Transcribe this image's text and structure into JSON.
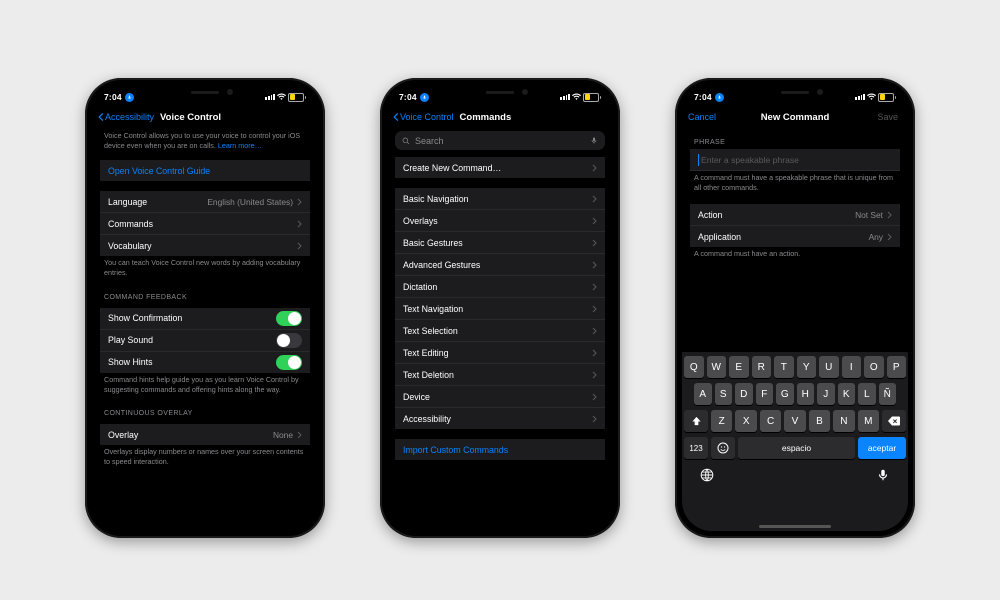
{
  "status": {
    "time": "7:04"
  },
  "p1": {
    "back": "Accessibility",
    "title": "Voice Control",
    "intro_a": "Voice Control allows you to use your voice to control your iOS device even when you are on calls. ",
    "intro_link": "Learn more…",
    "guide": "Open Voice Control Guide",
    "lang_label": "Language",
    "lang_value": "English (United States)",
    "cmds": "Commands",
    "vocab": "Vocabulary",
    "vocab_note": "You can teach Voice Control new words by adding vocabulary entries.",
    "sec_feedback": "COMMAND FEEDBACK",
    "conf": "Show Confirmation",
    "sound": "Play Sound",
    "hints": "Show Hints",
    "hints_note": "Command hints help guide you as you learn Voice Control by suggesting commands and offering hints along the way.",
    "sec_overlay": "CONTINUOUS OVERLAY",
    "overlay": "Overlay",
    "overlay_val": "None",
    "overlay_note": "Overlays display numbers or names over your screen contents to speed interaction."
  },
  "p2": {
    "back": "Voice Control",
    "title": "Commands",
    "search_ph": "Search",
    "create": "Create New Command…",
    "categories": [
      "Basic Navigation",
      "Overlays",
      "Basic Gestures",
      "Advanced Gestures",
      "Dictation",
      "Text Navigation",
      "Text Selection",
      "Text Editing",
      "Text Deletion",
      "Device",
      "Accessibility"
    ],
    "import": "Import Custom Commands"
  },
  "p3": {
    "cancel": "Cancel",
    "title": "New Command",
    "save": "Save",
    "sec_phrase": "PHRASE",
    "phrase_ph": "Enter a speakable phrase",
    "phrase_note": "A command must have a speakable phrase that is unique from all other commands.",
    "action": "Action",
    "action_val": "Not Set",
    "app": "Application",
    "app_val": "Any",
    "action_note": "A command must have an action.",
    "kbd": {
      "row1": [
        "Q",
        "W",
        "E",
        "R",
        "T",
        "Y",
        "U",
        "I",
        "O",
        "P"
      ],
      "row2": [
        "A",
        "S",
        "D",
        "F",
        "G",
        "H",
        "J",
        "K",
        "L",
        "Ñ"
      ],
      "row3": [
        "Z",
        "X",
        "C",
        "V",
        "B",
        "N",
        "M"
      ],
      "num": "123",
      "space": "espacio",
      "accept": "aceptar"
    }
  }
}
